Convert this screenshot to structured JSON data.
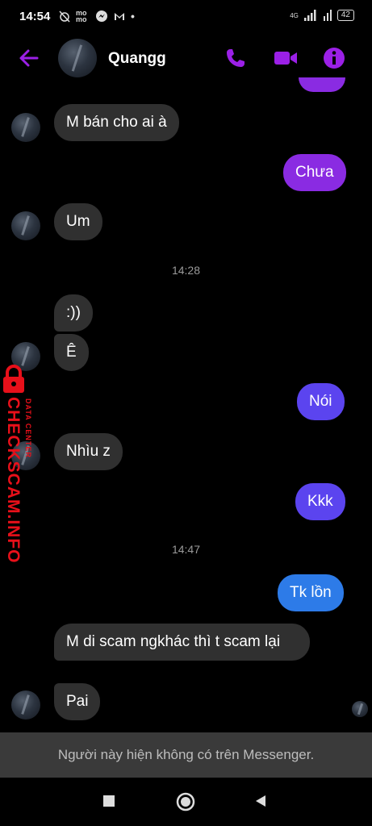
{
  "status": {
    "time": "14:54",
    "app_icons": "mo mo",
    "network": "4G",
    "battery": "42"
  },
  "header": {
    "contact_name": "Quangg",
    "back_icon": "back-arrow-icon",
    "call_icon": "phone-icon",
    "video_icon": "video-icon",
    "info_icon": "info-icon",
    "accent": "#9b20e6"
  },
  "messages": [
    {
      "text": "M bán cho ai à",
      "dir": "in"
    },
    {
      "text": "Chưa",
      "dir": "out"
    },
    {
      "text": "Um",
      "dir": "in"
    },
    {
      "text": ":))",
      "dir": "in"
    },
    {
      "text": "Ê",
      "dir": "in"
    },
    {
      "text": "Nói",
      "dir": "out"
    },
    {
      "text": "Nhìu z",
      "dir": "in"
    },
    {
      "text": "Kkk",
      "dir": "out"
    },
    {
      "text": "Tk lồn",
      "dir": "out"
    },
    {
      "text": "M di scam ngkhác thì t scam lại",
      "dir": "in"
    },
    {
      "text": "Pai",
      "dir": "in"
    }
  ],
  "timestamps": [
    "14:28",
    "14:47"
  ],
  "watermark": {
    "text": "CHECKSCAM.INFO",
    "sub": "DATA CENTER",
    "color": "#e8101a"
  },
  "notice": "Người này hiện không có trên Messenger.",
  "navbar": {
    "recents": "square-icon",
    "home": "circle-icon",
    "back": "triangle-back-icon"
  }
}
